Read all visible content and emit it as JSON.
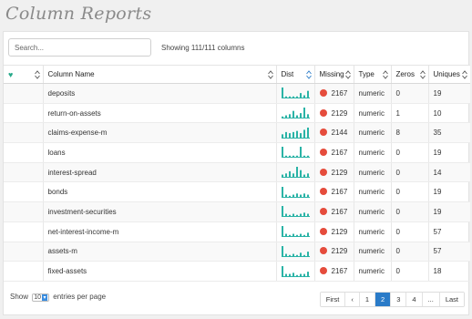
{
  "title": "Column Reports",
  "search": {
    "placeholder": "Search..."
  },
  "showing_text": "Showing 111/111 columns",
  "colors": {
    "accent": "#2a7bc8",
    "bars": "#2ab3a6",
    "missing_dot": "#e54c3c",
    "heart": "#27a98a"
  },
  "columns": {
    "fav_icon": "heart-icon",
    "name": "Column Name",
    "dist": "Dist",
    "missing": "Missing",
    "type": "Type",
    "zeros": "Zeros",
    "uniques": "Uniques"
  },
  "rows": [
    {
      "name": "deposits",
      "dist": [
        9,
        1,
        1,
        1,
        1,
        4,
        2,
        6
      ],
      "missing": "2167",
      "type": "numeric",
      "zeros": "0",
      "uniques": "19"
    },
    {
      "name": "return-on-assets",
      "dist": [
        1,
        2,
        3,
        6,
        2,
        4,
        9,
        3
      ],
      "missing": "2129",
      "type": "numeric",
      "zeros": "1",
      "uniques": "10"
    },
    {
      "name": "claims-expense-m",
      "dist": [
        3,
        5,
        4,
        5,
        6,
        4,
        7,
        9
      ],
      "missing": "2144",
      "type": "numeric",
      "zeros": "8",
      "uniques": "35"
    },
    {
      "name": "loans",
      "dist": [
        9,
        1,
        1,
        1,
        1,
        9,
        1,
        1
      ],
      "missing": "2167",
      "type": "numeric",
      "zeros": "0",
      "uniques": "19"
    },
    {
      "name": "interest-spread",
      "dist": [
        2,
        3,
        5,
        3,
        9,
        6,
        2,
        3
      ],
      "missing": "2129",
      "type": "numeric",
      "zeros": "0",
      "uniques": "14"
    },
    {
      "name": "bonds",
      "dist": [
        9,
        2,
        1,
        2,
        3,
        2,
        3,
        2
      ],
      "missing": "2167",
      "type": "numeric",
      "zeros": "0",
      "uniques": "19"
    },
    {
      "name": "investment-securities",
      "dist": [
        9,
        2,
        1,
        2,
        1,
        2,
        3,
        2
      ],
      "missing": "2167",
      "type": "numeric",
      "zeros": "0",
      "uniques": "19"
    },
    {
      "name": "net-interest-income-m",
      "dist": [
        9,
        2,
        1,
        2,
        1,
        2,
        1,
        3
      ],
      "missing": "2129",
      "type": "numeric",
      "zeros": "0",
      "uniques": "57"
    },
    {
      "name": "assets-m",
      "dist": [
        9,
        2,
        1,
        2,
        1,
        3,
        1,
        4
      ],
      "missing": "2129",
      "type": "numeric",
      "zeros": "0",
      "uniques": "57"
    },
    {
      "name": "fixed-assets",
      "dist": [
        9,
        2,
        2,
        3,
        1,
        2,
        2,
        4
      ],
      "missing": "2167",
      "type": "numeric",
      "zeros": "0",
      "uniques": "18"
    }
  ],
  "footer": {
    "show_label": "Show",
    "entries_value": "10",
    "entries_label": "entries per page"
  },
  "pagination": {
    "first": "First",
    "prev": "‹",
    "pages": [
      "1",
      "2",
      "3",
      "4",
      "..."
    ],
    "current": "2",
    "last": "Last"
  }
}
